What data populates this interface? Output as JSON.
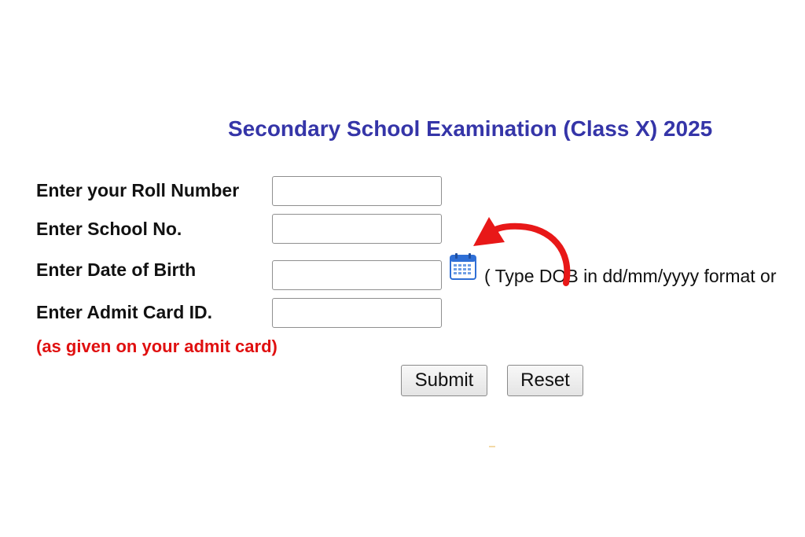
{
  "header": {
    "title": "Secondary School Examination (Class X) 2025"
  },
  "form": {
    "roll_number": {
      "label": "Enter your Roll Number",
      "value": ""
    },
    "school_no": {
      "label": "Enter School No.",
      "value": ""
    },
    "dob": {
      "label": "Enter Date of Birth",
      "value": "",
      "hint": "( Type DOB in dd/mm/yyyy format or",
      "icon": "calendar-icon"
    },
    "admit_card_id": {
      "label": "Enter Admit Card ID.",
      "value": ""
    },
    "admit_card_note": "(as given on your admit card)"
  },
  "buttons": {
    "submit_label": "Submit",
    "reset_label": "Reset"
  },
  "colors": {
    "title": "#3535a8",
    "note": "#e01010",
    "arrow": "#e81818",
    "calendar": "#2f6fd6"
  }
}
